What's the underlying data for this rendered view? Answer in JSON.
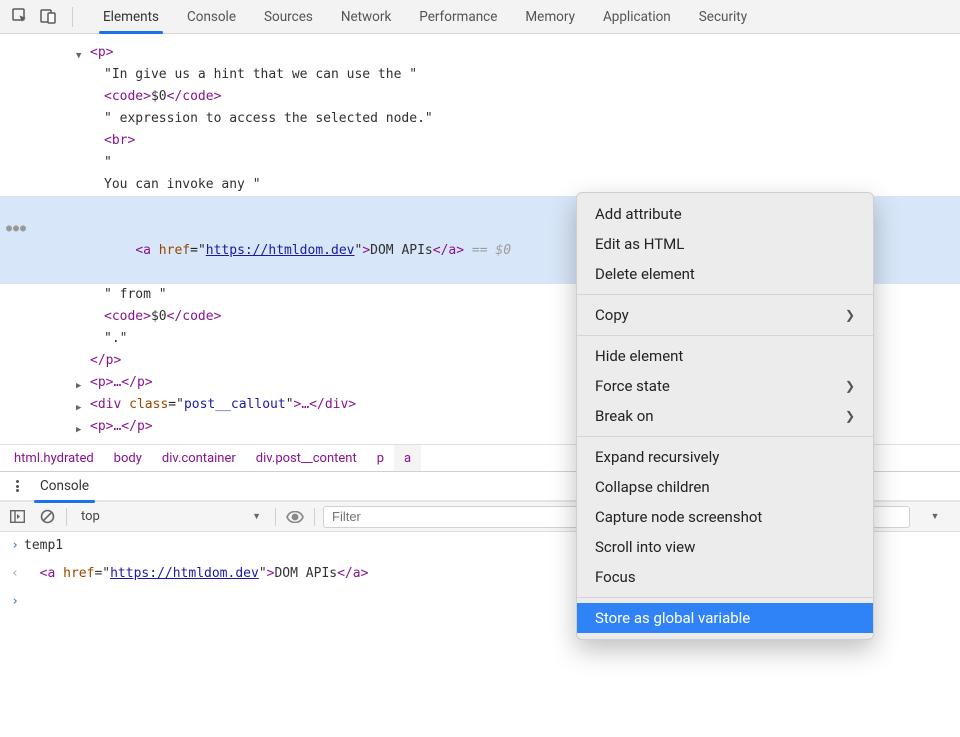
{
  "tabs": {
    "elements": "Elements",
    "console": "Console",
    "sources": "Sources",
    "network": "Network",
    "performance": "Performance",
    "memory": "Memory",
    "application": "Application",
    "security": "Security"
  },
  "dom": {
    "pOpen": "<p>",
    "text1": "\"In give us a hint that we can use the \"",
    "code1Open": "<code>",
    "dollar0": "$0",
    "code1Close": "</code>",
    "text2": "\" expression to access the selected node.\"",
    "br": "<br>",
    "quoteLine": "\"",
    "text3": "You can invoke any \"",
    "aOpen1": "<a ",
    "hrefName": "href",
    "eq": "=",
    "hrefQuote": "\"",
    "hrefVal": "https://htmldom.dev",
    "aOpen2": ">",
    "linkText": "DOM APIs",
    "aClose": "</a>",
    "selSuffix": " == $0",
    "text4": "\" from \"",
    "code2Open": "<code>",
    "code2Close": "</code>",
    "textDot": "\".\"",
    "pClose": "</p>",
    "pEllipsis": "<p>…</p>",
    "divOpen": "<div ",
    "classAttr": "class",
    "classVal": "post__callout",
    "divOpenEnd": ">…</div>",
    "pEllipsis2": "<p>…</p>"
  },
  "crumbs": {
    "c1": "html.hydrated",
    "c2": "body",
    "c3": "div.container",
    "c4": "div.post__content",
    "c5": "p",
    "c6": "a"
  },
  "console_header": {
    "title": "Console"
  },
  "filter": {
    "context": "top",
    "placeholder": "Filter"
  },
  "console_lines": {
    "temp1": "temp1",
    "aOpen1": "<a ",
    "hrefName": "href",
    "hrefVal": "https://htmldom.dev",
    "aOpen2": ">",
    "linkText": "DOM APIs",
    "aClose": "</a>"
  },
  "menu": {
    "addAttr": "Add attribute",
    "editHtml": "Edit as HTML",
    "deleteElem": "Delete element",
    "copy": "Copy",
    "hideElem": "Hide element",
    "forceState": "Force state",
    "breakOn": "Break on",
    "expandRecur": "Expand recursively",
    "collapseChildren": "Collapse children",
    "captureNode": "Capture node screenshot",
    "scrollInto": "Scroll into view",
    "focus": "Focus",
    "storeGlobal": "Store as global variable"
  }
}
